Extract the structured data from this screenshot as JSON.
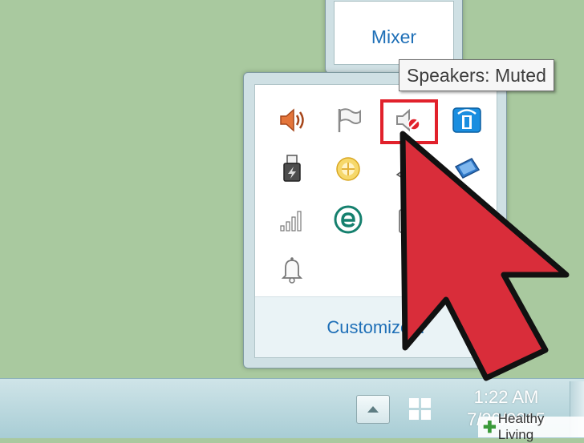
{
  "mixer": {
    "label": "Mixer"
  },
  "tooltip": {
    "text": "Speakers: Muted"
  },
  "tray": {
    "icons": [
      {
        "name": "volume-speaker-icon"
      },
      {
        "name": "action-center-flag-icon"
      },
      {
        "name": "speaker-muted-icon"
      },
      {
        "name": "network-adapter-icon"
      },
      {
        "name": "usb-device-icon"
      },
      {
        "name": "sun-status-icon"
      },
      {
        "name": "usb-drive-icon"
      },
      {
        "name": "display-monitor-icon"
      },
      {
        "name": "signal-bars-icon"
      },
      {
        "name": "eset-antivirus-icon"
      },
      {
        "name": "clipboard-icon"
      },
      {
        "name": "notification-bell-icon"
      }
    ],
    "customize_label": "Customize..."
  },
  "taskbar": {
    "time": "1:22 AM",
    "date": "7/20/2015"
  },
  "brand": {
    "text": "Healthy Living"
  },
  "colors": {
    "highlight": "#e1212b",
    "arrow": "#d92d3a",
    "link": "#1e6fb7"
  }
}
